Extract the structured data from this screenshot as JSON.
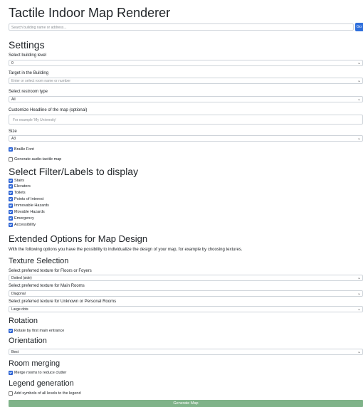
{
  "app": {
    "title": "Tactile Indoor Map Renderer"
  },
  "search": {
    "placeholder": "Search building name or address...",
    "go_label": "Go"
  },
  "settings": {
    "heading": "Settings",
    "level": {
      "label": "Select building level",
      "value": "0"
    },
    "target": {
      "label": "Target in the Building",
      "placeholder": "Enter or select room name or number"
    },
    "restroom": {
      "label": "Select restroom type",
      "value": "All"
    },
    "headline": {
      "label": "Customize Headline of the map (optional)",
      "placeholder": "For example 'My University'"
    },
    "size": {
      "label": "Size",
      "value": "A3"
    },
    "braille": {
      "label": "Braille Font",
      "checked": true
    },
    "audio": {
      "label": "Generate audio-tactile map",
      "checked": false
    }
  },
  "filters": {
    "heading": "Select Filter/Labels to display",
    "items": [
      {
        "label": "Stairs",
        "checked": true
      },
      {
        "label": "Elevators",
        "checked": true
      },
      {
        "label": "Toilets",
        "checked": true
      },
      {
        "label": "Points of Interest",
        "checked": true
      },
      {
        "label": "Immovable Hazards",
        "checked": true
      },
      {
        "label": "Movable Hazards",
        "checked": true
      },
      {
        "label": "Emergency",
        "checked": true
      },
      {
        "label": "Accessibility",
        "checked": true
      }
    ]
  },
  "extended": {
    "heading": "Extended Options for Map Design",
    "description": "With the following options you have the possibility to individualize the design of your map, for example by choosing textures."
  },
  "texture": {
    "heading": "Texture Selection",
    "floors": {
      "label": "Select preferred texture for Floors or Foyers",
      "value": "Dotted (side)"
    },
    "main_rooms": {
      "label": "Select preferred texture for Main Rooms",
      "value": "Diagonal"
    },
    "unknown_rooms": {
      "label": "Select preferred texture for Unknown or Personal Rooms",
      "value": "Large dots"
    }
  },
  "rotation": {
    "heading": "Rotation",
    "option": {
      "label": "Rotate by first main entrance",
      "checked": true
    }
  },
  "orientation": {
    "heading": "Orientation",
    "value": "Best"
  },
  "merging": {
    "heading": "Room merging",
    "option": {
      "label": "Merge rooms to reduce clutter",
      "checked": true
    }
  },
  "legend": {
    "heading": "Legend generation",
    "option": {
      "label": "Add symbols of all levels to the legend",
      "checked": false
    }
  },
  "generate": {
    "label": "Generate Map"
  }
}
